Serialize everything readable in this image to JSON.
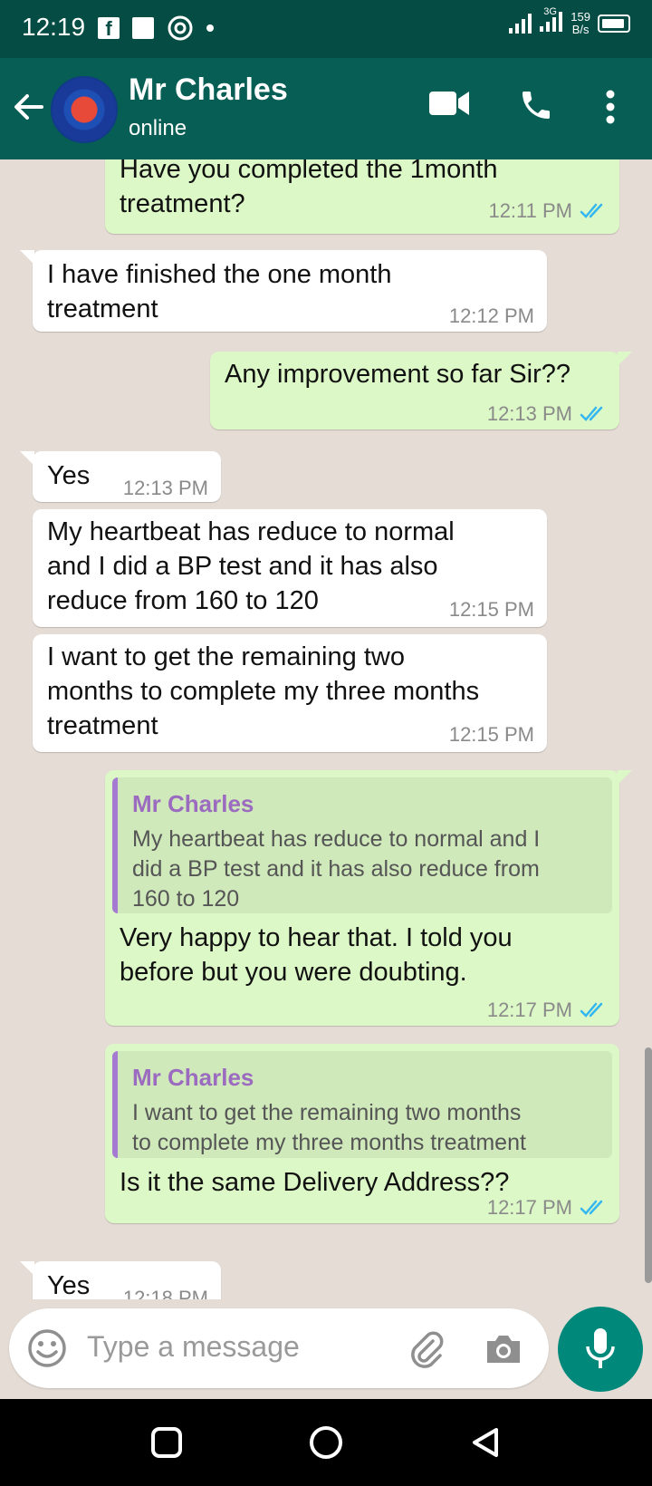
{
  "status_bar": {
    "time": "12:19",
    "fb_glyph": "f",
    "network": "3G",
    "speed_top": "159",
    "speed_bottom": "B/s"
  },
  "header": {
    "contact_name": "Mr Charles",
    "contact_status": "online"
  },
  "messages": [
    {
      "direction": "out",
      "text_lines": [
        "Have you completed the 1month",
        "treatment?"
      ],
      "time": "12:11 PM",
      "ticks": "read"
    },
    {
      "direction": "in",
      "text_lines": [
        "I have finished the one month",
        "treatment"
      ],
      "time": "12:12 PM"
    },
    {
      "direction": "out",
      "text_lines": [
        "Any improvement so far Sir??"
      ],
      "time": "12:13 PM",
      "ticks": "read"
    },
    {
      "direction": "in",
      "text_lines": [
        "Yes"
      ],
      "time": "12:13 PM"
    },
    {
      "direction": "in",
      "text_lines": [
        "My heartbeat has reduce to normal",
        "and I did a BP test and it has also",
        "reduce from 160 to 120"
      ],
      "time": "12:15 PM"
    },
    {
      "direction": "in",
      "text_lines": [
        "I want to get the remaining two",
        "months to complete my three months",
        "treatment"
      ],
      "time": "12:15 PM"
    },
    {
      "direction": "out",
      "quote_author": "Mr Charles",
      "quote_lines": [
        "My heartbeat has reduce to normal and I",
        "did a BP test and it has also reduce from",
        "160 to 120"
      ],
      "text_lines": [
        "Very happy to hear that. I told you",
        "before but you were doubting."
      ],
      "time": "12:17 PM",
      "ticks": "read"
    },
    {
      "direction": "out",
      "quote_author": "Mr Charles",
      "quote_lines": [
        "I want to get the remaining two months",
        "to complete my three months treatment"
      ],
      "text_lines": [
        "Is it the same Delivery Address??"
      ],
      "time": "12:17 PM",
      "ticks": "read"
    },
    {
      "direction": "in",
      "text_lines": [
        "Yes"
      ],
      "time": "12:18 PM"
    }
  ],
  "composer": {
    "placeholder": "Type a message"
  },
  "colors": {
    "header": "#075e54",
    "status_bar": "#054d44",
    "chat_bg": "#e5ddd5",
    "outgoing": "#dcf8c6",
    "incoming": "#ffffff",
    "read_ticks": "#34b7f1",
    "mic": "#00897b"
  },
  "icons": [
    "back-arrow-icon",
    "video-call-icon",
    "voice-call-icon",
    "more-options-icon",
    "emoji-icon",
    "attach-icon",
    "camera-icon",
    "mic-icon",
    "double-tick-icon"
  ]
}
